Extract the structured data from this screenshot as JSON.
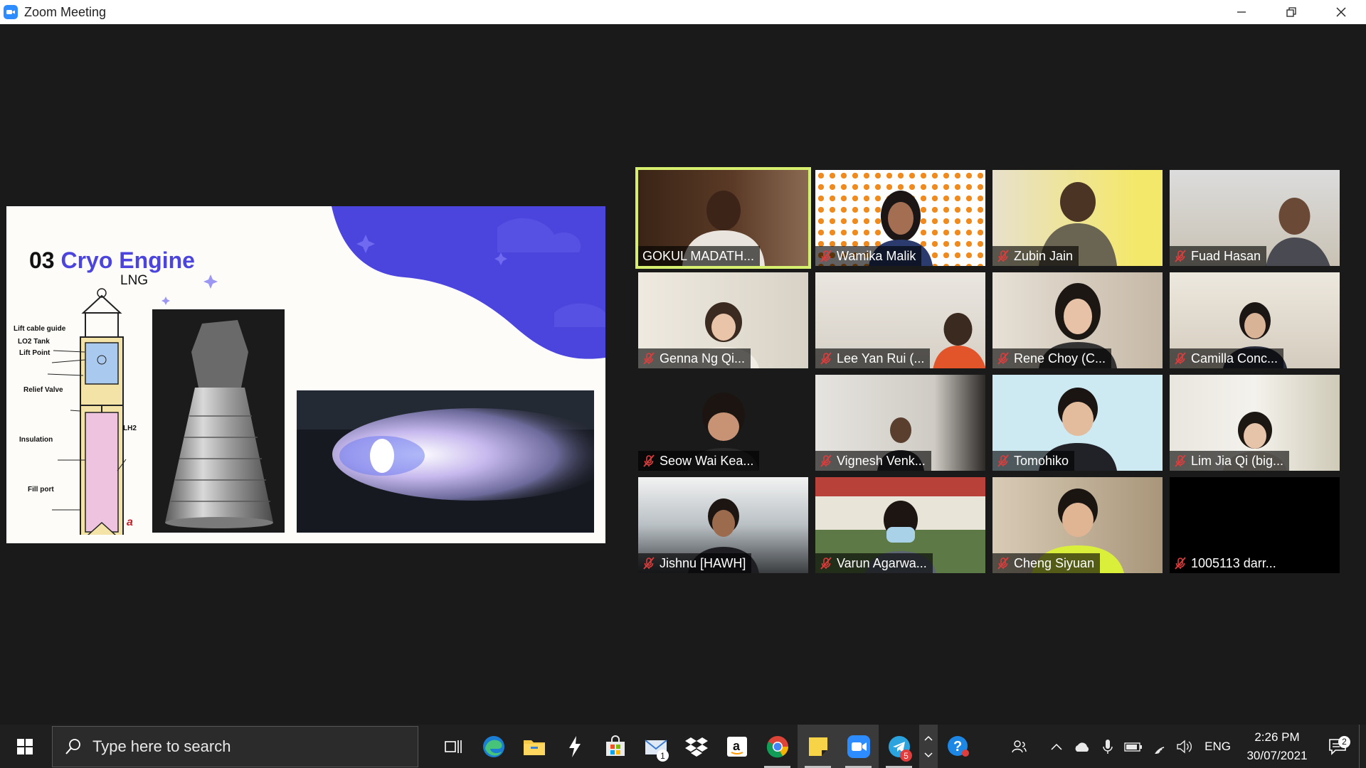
{
  "window": {
    "title": "Zoom Meeting",
    "icon": "zoom-app-icon",
    "controls": [
      "minimize-icon",
      "restore-icon",
      "close-icon"
    ]
  },
  "slide": {
    "number": "03",
    "title": "Cryo Engine",
    "subtitle": "LNG",
    "accent_color": "#4b45de",
    "diagram_labels": {
      "lift_cable_guide": "Lift cable guide",
      "lo2_tank": "LO2 Tank",
      "lift_point": "Lift Point",
      "relief_valve": "Relief Valve",
      "insulation": "Insulation",
      "fill_port": "Fill port",
      "lh2": "LH2",
      "figure_letter": "a"
    }
  },
  "participants": [
    {
      "name": "GOKUL MADATH...",
      "active_speaker": true,
      "muted": false
    },
    {
      "name": "Wamika Malik",
      "muted": true
    },
    {
      "name": "Zubin Jain",
      "muted": true
    },
    {
      "name": "Fuad Hasan",
      "muted": true
    },
    {
      "name": "Genna Ng Qi...",
      "muted": true
    },
    {
      "name": "Lee Yan Rui (...",
      "muted": true
    },
    {
      "name": "Rene Choy (C...",
      "muted": true
    },
    {
      "name": "Camilla Conc...",
      "muted": true
    },
    {
      "name": "Seow Wai Kea...",
      "muted": true
    },
    {
      "name": "Vignesh Venk...",
      "muted": true
    },
    {
      "name": "Tomohiko",
      "muted": true
    },
    {
      "name": "Lim Jia Qi (big...",
      "muted": true
    },
    {
      "name": "Jishnu [HAWH]",
      "muted": true
    },
    {
      "name": "Varun Agarwa...",
      "muted": true
    },
    {
      "name": "Cheng Siyuan",
      "muted": true
    },
    {
      "name": "1005113 darr...",
      "muted": true
    }
  ],
  "taskbar": {
    "search_placeholder": "Type here to search",
    "apps": [
      {
        "icon": "task-view-icon"
      },
      {
        "icon": "edge-icon"
      },
      {
        "icon": "file-explorer-icon"
      },
      {
        "icon": "fusion-lightning-icon"
      },
      {
        "icon": "microsoft-store-icon"
      },
      {
        "icon": "mail-icon",
        "badge": "1"
      },
      {
        "icon": "dropbox-icon"
      },
      {
        "icon": "amazon-icon"
      },
      {
        "icon": "chrome-icon"
      },
      {
        "icon": "sticky-notes-icon"
      },
      {
        "icon": "zoom-icon"
      },
      {
        "icon": "telegram-icon",
        "badge": "5"
      }
    ],
    "tray": {
      "language": "ENG",
      "time": "2:26 PM",
      "date": "30/07/2021",
      "notifications": "2"
    }
  },
  "colors": {
    "active_speaker_border": "#d6ef6e",
    "meeting_bg": "#1a1a1a",
    "taskbar_bg": "#1f1f1f"
  }
}
